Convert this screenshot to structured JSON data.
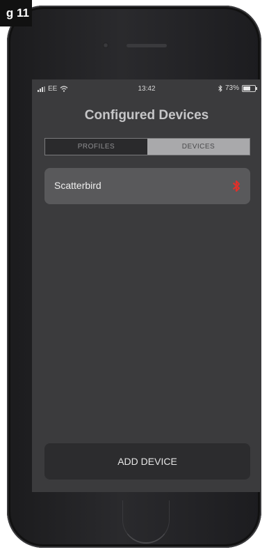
{
  "figure_label": "g 11",
  "status_bar": {
    "carrier": "EE",
    "time": "13:42",
    "battery": "73%",
    "battery_level": 0.73
  },
  "header": {
    "title": "Configured Devices"
  },
  "tabs": [
    {
      "label": "PROFILES",
      "selected": false
    },
    {
      "label": "DEVICES",
      "selected": true
    }
  ],
  "devices": [
    {
      "name": "Scatterbird",
      "status_icon": "bluetooth-icon",
      "status_color": "#e0302a"
    }
  ],
  "actions": {
    "add_device": "ADD DEVICE"
  },
  "colors": {
    "screen_bg": "#3b3b3d",
    "accent_red": "#e0302a"
  }
}
